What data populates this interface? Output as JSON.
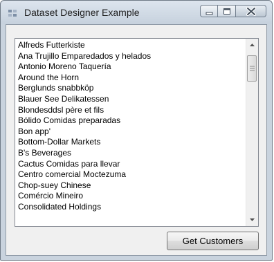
{
  "window": {
    "title": "Dataset Designer Example",
    "icon": "form-app-icon"
  },
  "caption_buttons": {
    "minimize": "minimize-icon",
    "maximize": "maximize-icon",
    "close": "close-icon"
  },
  "customers": [
    "Alfreds Futterkiste",
    "Ana Trujillo Emparedados y helados",
    "Antonio Moreno Taquería",
    "Around the Horn",
    "Berglunds snabbköp",
    "Blauer See Delikatessen",
    "Blondesddsl père et fils",
    "Bólido Comidas preparadas",
    "Bon app'",
    "Bottom-Dollar Markets",
    "B's Beverages",
    "Cactus Comidas para llevar",
    "Centro comercial Moctezuma",
    "Chop-suey Chinese",
    "Comércio Mineiro",
    "Consolidated Holdings"
  ],
  "scrollbar": {
    "up": "scroll-up-arrow-icon",
    "down": "scroll-down-arrow-icon"
  },
  "actions": {
    "get_customers_label": "Get Customers"
  }
}
